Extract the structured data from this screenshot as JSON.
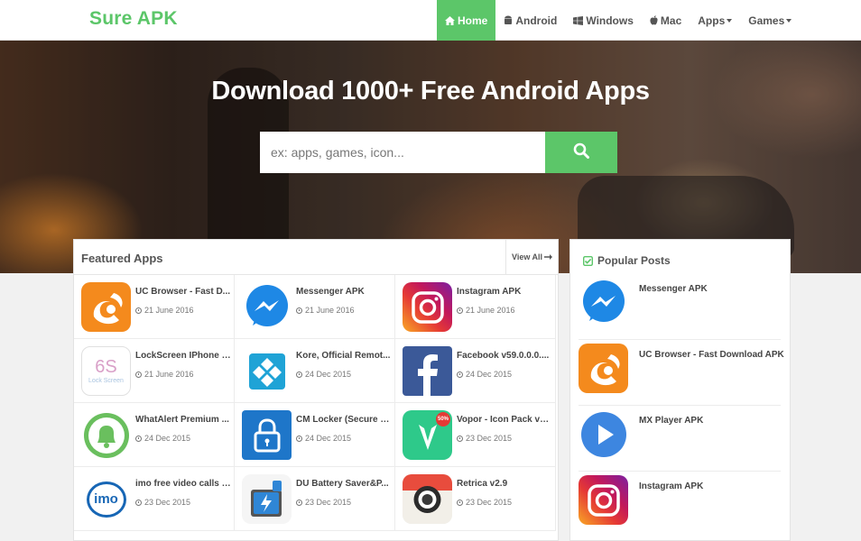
{
  "site": {
    "logo": "Sure APK"
  },
  "nav": [
    {
      "label": "Home",
      "icon": "home-icon"
    },
    {
      "label": "Android",
      "icon": "android-icon"
    },
    {
      "label": "Windows",
      "icon": "windows-icon"
    },
    {
      "label": "Mac",
      "icon": "apple-icon"
    },
    {
      "label": "Apps"
    },
    {
      "label": "Games"
    }
  ],
  "hero": {
    "title": "Download 1000+ Free Android Apps",
    "search_placeholder": "ex: apps, games, icon..."
  },
  "featured": {
    "title": "Featured Apps",
    "view_all": "View All",
    "apps": [
      {
        "name": "UC Browser - Fast D...",
        "date": "21 June 2016",
        "icon": "uc-browser-icon"
      },
      {
        "name": "Messenger APK",
        "date": "21 June 2016",
        "icon": "messenger-icon"
      },
      {
        "name": "Instagram APK",
        "date": "21 June 2016",
        "icon": "instagram-icon"
      },
      {
        "name": "LockScreen IPhone 6...",
        "date": "21 June 2016",
        "icon": "lockscreen-6s-icon",
        "icon_text": "6S",
        "icon_sub": "Lock Screen"
      },
      {
        "name": "Kore, Official Remot...",
        "date": "24 Dec 2015",
        "icon": "kodi-icon"
      },
      {
        "name": "Facebook v59.0.0.0....",
        "date": "24 Dec 2015",
        "icon": "facebook-icon"
      },
      {
        "name": "WhatAlert Premium ...",
        "date": "24 Dec 2015",
        "icon": "bell-icon"
      },
      {
        "name": "CM Locker (Secure &...",
        "date": "24 Dec 2015",
        "icon": "padlock-icon"
      },
      {
        "name": "Vopor - Icon Pack v5....",
        "date": "23 Dec 2015",
        "icon": "vopor-icon",
        "icon_badge": "50%"
      },
      {
        "name": "imo free video calls a...",
        "date": "23 Dec 2015",
        "icon": "imo-icon",
        "icon_text": "imo"
      },
      {
        "name": "DU Battery Saver&P...",
        "date": "23 Dec 2015",
        "icon": "battery-icon"
      },
      {
        "name": "Retrica v2.9",
        "date": "23 Dec 2015",
        "icon": "retrica-icon"
      }
    ]
  },
  "popular": {
    "title": "Popular Posts",
    "items": [
      {
        "name": "Messenger APK",
        "icon": "messenger-icon"
      },
      {
        "name": "UC Browser - Fast Download APK",
        "icon": "uc-browser-icon"
      },
      {
        "name": "MX Player APK",
        "icon": "play-icon"
      },
      {
        "name": "Instagram APK",
        "icon": "instagram-icon"
      }
    ]
  },
  "colors": {
    "accent": "#5cc669",
    "text": "#444444",
    "background": "#f1f1f1"
  }
}
